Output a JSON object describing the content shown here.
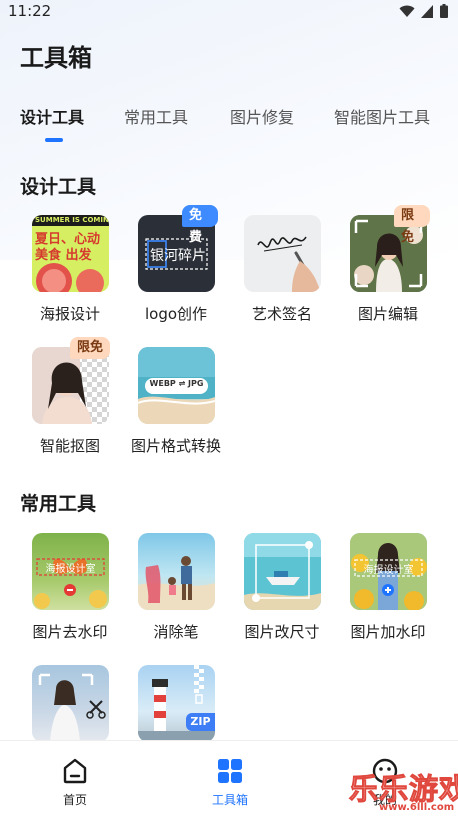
{
  "status_bar": {
    "time": "11:22"
  },
  "page_title": "工具箱",
  "tabs": [
    {
      "label": "设计工具",
      "active": true
    },
    {
      "label": "常用工具",
      "active": false
    },
    {
      "label": "图片修复",
      "active": false
    },
    {
      "label": "智能图片工具",
      "active": false
    }
  ],
  "sections": {
    "design": {
      "title": "设计工具",
      "tools": [
        {
          "label": "海报设计",
          "thumb_text": [
            "SUMMER IS COMING",
            "夏日、心动",
            "美食  出发"
          ]
        },
        {
          "label": "logo创作",
          "badge": "免费",
          "thumb_text": [
            "银河碎片"
          ]
        },
        {
          "label": "艺术签名"
        },
        {
          "label": "图片编辑",
          "badge": "限免"
        },
        {
          "label": "智能抠图",
          "badge": "限免"
        },
        {
          "label": "图片格式转换",
          "thumb_text": [
            "WEBP ⇌ JPG"
          ]
        }
      ]
    },
    "common": {
      "title": "常用工具",
      "tools": [
        {
          "label": "图片去水印",
          "thumb_text": [
            "海报设计室"
          ]
        },
        {
          "label": "消除笔"
        },
        {
          "label": "图片改尺寸"
        },
        {
          "label": "图片加水印",
          "thumb_text": [
            "海报设计室"
          ]
        },
        {
          "label": ""
        },
        {
          "label": "",
          "thumb_text": [
            "ZIP"
          ]
        }
      ]
    }
  },
  "bottom_nav": [
    {
      "label": "首页",
      "icon": "home-icon",
      "active": false
    },
    {
      "label": "工具箱",
      "icon": "grid-icon",
      "active": true
    },
    {
      "label": "我的",
      "icon": "face-icon",
      "active": false
    }
  ],
  "watermark": {
    "text": "乐乐游戏",
    "url": "www.6lll.com"
  },
  "colors": {
    "accent": "#1f74ff",
    "badge_free": "#3d8bff",
    "badge_limited": "#ffd8bd"
  }
}
